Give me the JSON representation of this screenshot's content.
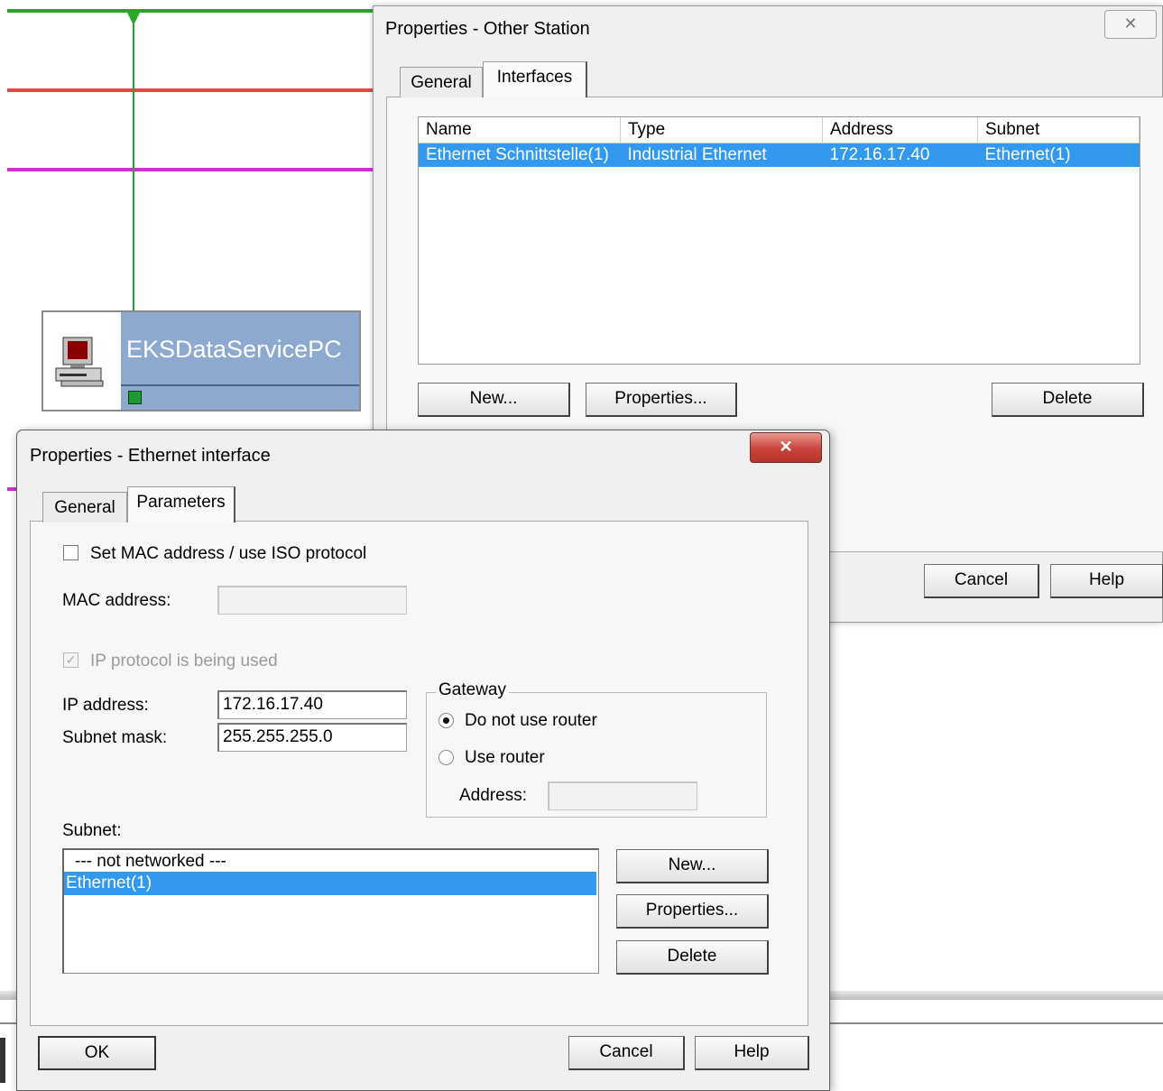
{
  "canvas": {
    "station_name": "EKSDataServicePC",
    "line_colors": {
      "green": "#2aa52a",
      "red": "#e84545",
      "magenta": "#cc33cc"
    }
  },
  "back_dialog": {
    "title": "Properties - Other Station",
    "close_glyph": "✕",
    "tabs": [
      "General",
      "Interfaces"
    ],
    "active_tab": "Interfaces",
    "columns": [
      "Name",
      "Type",
      "Address",
      "Subnet"
    ],
    "rows": [
      {
        "name": "Ethernet Schnittstelle(1)",
        "type": "Industrial Ethernet",
        "address": "172.16.17.40",
        "subnet": "Ethernet(1)"
      }
    ],
    "buttons": {
      "new": "New...",
      "properties": "Properties...",
      "delete": "Delete",
      "cancel": "Cancel",
      "help": "Help"
    }
  },
  "front_dialog": {
    "title": "Properties - Ethernet interface",
    "close_glyph": "✕",
    "tabs": [
      "General",
      "Parameters"
    ],
    "active_tab": "Parameters",
    "mac_checkbox_label": "Set MAC address / use ISO protocol",
    "mac_checked": false,
    "mac_label": "MAC address:",
    "mac_value": "",
    "ip_used_label": "IP protocol is being used",
    "ip_used_checked": true,
    "ip_label": "IP address:",
    "ip_value": "172.16.17.40",
    "mask_label": "Subnet mask:",
    "mask_value": "255.255.255.0",
    "gateway": {
      "legend": "Gateway",
      "option_no_router": "Do not use router",
      "option_use_router": "Use router",
      "selected": "Do not use router",
      "address_label": "Address:",
      "address_value": ""
    },
    "subnet_label": "Subnet:",
    "subnet_items": [
      "--- not networked ---",
      "Ethernet(1)"
    ],
    "subnet_selected": "Ethernet(1)",
    "subnet_buttons": {
      "new": "New...",
      "properties": "Properties...",
      "delete": "Delete"
    },
    "buttons": {
      "ok": "OK",
      "cancel": "Cancel",
      "help": "Help"
    }
  },
  "colors": {
    "selection": "#3399ee",
    "close_button": "#c9433c"
  }
}
